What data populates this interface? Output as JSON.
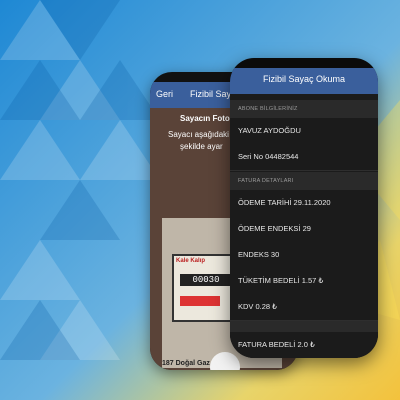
{
  "background": {
    "colors": [
      "#1e88d4",
      "#f3d04c",
      "#7fb8e6"
    ]
  },
  "back_phone": {
    "nav_back": "Geri",
    "nav_title": "Fizibil Sayaç",
    "camera_title": "Sayacın Fotoğra",
    "instruction_line1": "Sayacı aşağıdaki çe",
    "instruction_line2": "şekilde ayar",
    "meter_brand": "Kale Kalıp",
    "meter_reading": "00030",
    "meter_footer": "187 Doğal Gaz Act"
  },
  "front_phone": {
    "title": "Fizibil Sayaç Okuma",
    "sections": {
      "subscriber": {
        "header": "ABONE BİLGİLERİNİZ",
        "name": "YAVUZ AYDOĞDU",
        "serial": "Seri No  04482544"
      },
      "invoice": {
        "header": "FATURA DETAYLARI",
        "due_date": "ÖDEME TARİHİ  29.11.2020",
        "index_paid": "ÖDEME ENDEKSİ  29",
        "index": "ENDEKS  30",
        "consumption": "TÜKETİM BEDELİ  1.57 ₺",
        "vat": "KDV  0.28 ₺",
        "total": "FATURA BEDELİ  2.0 ₺"
      }
    }
  }
}
